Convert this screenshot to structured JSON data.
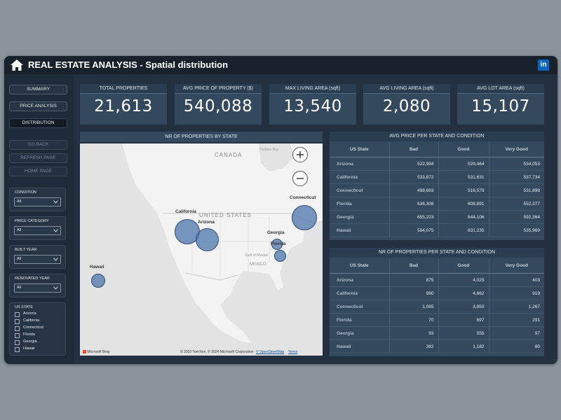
{
  "header": {
    "title": "REAL ESTATE ANALYSIS - Spatial distribution",
    "home_icon": "home-icon",
    "linkedin_icon": "linkedin-icon",
    "linkedin_text": "in"
  },
  "nav": {
    "summary": "SUMMARY",
    "price_analysis": "PRICE ANALYSIS",
    "distribution": "DISTRIBUTION",
    "go_back": "GO BACK",
    "refresh": "REFRESH PAGE",
    "home": "HOME PAGE"
  },
  "filters": {
    "condition": {
      "label": "CONDITION",
      "value": "All"
    },
    "price_category": {
      "label": "PRICE CATEGORY",
      "value": "All"
    },
    "built_year": {
      "label": "BUILT YEAR",
      "value": "All"
    },
    "renovated_year": {
      "label": "RENOVATED YEAR",
      "value": "All"
    },
    "us_state": {
      "label": "US STATE",
      "options": [
        "Arizona",
        "California",
        "Connecticut",
        "Florida",
        "Georgia",
        "Hawaii"
      ]
    }
  },
  "kpis": [
    {
      "label": "TOTAL PROPERTIES",
      "value": "21,613"
    },
    {
      "label": "AVG PRICE OF PROPERTY ($)",
      "value": "540,088"
    },
    {
      "label": "MAX LIVING AREA (sqft)",
      "value": "13,540"
    },
    {
      "label": "AVG LIVING AREA (sqft)",
      "value": "2,080"
    },
    {
      "label": "AVG LOT AREA (sqft)",
      "value": "15,107"
    }
  ],
  "map": {
    "title": "NR OF PROPERTIES BY STATE",
    "labels": {
      "canada": "CANADA",
      "united_states": "UNITED STATES",
      "mexico": "MEXICO",
      "hudson_bay": "Hudson Bay",
      "gulf": "Gulf of Mexico",
      "arizona": "Arizona",
      "california": "California",
      "connecticut": "Connecticut",
      "georgia": "Georgia",
      "florida": "Florida",
      "hawaii": "Hawaii"
    },
    "zoom_in": "zoom-in-icon",
    "zoom_out": "zoom-out-icon",
    "bing": "Microsoft Bing",
    "attribution": "© 2023 TomTom, © 2024 Microsoft Corporation",
    "osm": "© OpenStreetMap",
    "terms": "Terms"
  },
  "avg_price_table": {
    "title": "AVG PRICE PER STATE AND CONDITION",
    "columns": [
      "US State",
      "Bad",
      "Good",
      "Very Good"
    ],
    "rows": [
      [
        "Arizona",
        "522,994",
        "529,464",
        "534,053"
      ],
      [
        "California",
        "533,872",
        "531,631",
        "537,734"
      ],
      [
        "Connecticut",
        "498,693",
        "516,579",
        "531,898"
      ],
      [
        "Florida",
        "636,308",
        "608,891",
        "552,377"
      ],
      [
        "Georgia",
        "655,223",
        "644,106",
        "592,364"
      ],
      [
        "Hawaii",
        "584,075",
        "631,235",
        "535,969"
      ]
    ]
  },
  "count_table": {
    "title": "NR OF PROPERTIES PER STATE AND CONDITION",
    "columns": [
      "US State",
      "Bad",
      "Good",
      "Very Good"
    ],
    "rows": [
      [
        "Arizona",
        "875",
        "4,025",
        "403"
      ],
      [
        "California",
        "980",
        "4,662",
        "919"
      ],
      [
        "Connecticut",
        "1,085",
        "3,950",
        "1,267"
      ],
      [
        "Florida",
        "70",
        "697",
        "291"
      ],
      [
        "Georgia",
        "93",
        "555",
        "97"
      ],
      [
        "Hawaii",
        "382",
        "1,182",
        "80"
      ]
    ]
  }
}
